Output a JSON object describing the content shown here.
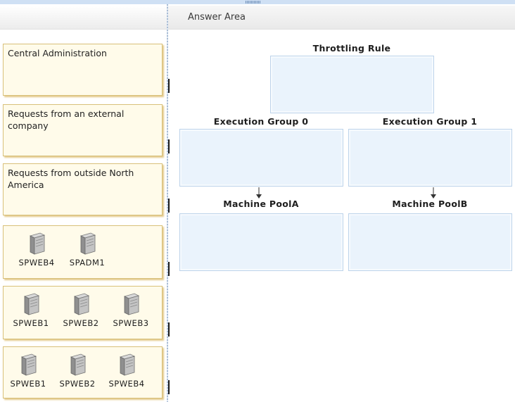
{
  "answer_area": {
    "title": "Answer Area"
  },
  "tiles": [
    {
      "text": "Central Administration"
    },
    {
      "text": "Requests from an external company"
    },
    {
      "text": "Requests from outside North America"
    },
    {
      "servers": [
        "SPWEB4",
        "SPADM1"
      ]
    },
    {
      "servers": [
        "SPWEB1",
        "SPWEB2",
        "SPWEB3"
      ]
    },
    {
      "servers": [
        "SPWEB1",
        "SPWEB2",
        "SPWEB4"
      ]
    }
  ],
  "targets": {
    "throttling_rule": "Throttling Rule",
    "execution_group_0": "Execution Group 0",
    "execution_group_1": "Execution Group 1",
    "machine_pool_a": "Machine PoolA",
    "machine_pool_b": "Machine PoolB"
  },
  "colors": {
    "tile_fill": "#fffbea",
    "tile_border": "#d8c07a",
    "drop_fill": "#eaf3fc",
    "drop_border": "#bdd3ea"
  },
  "icons": [
    "server-icon",
    "arrow-down-icon",
    "drag-grip-icon"
  ]
}
